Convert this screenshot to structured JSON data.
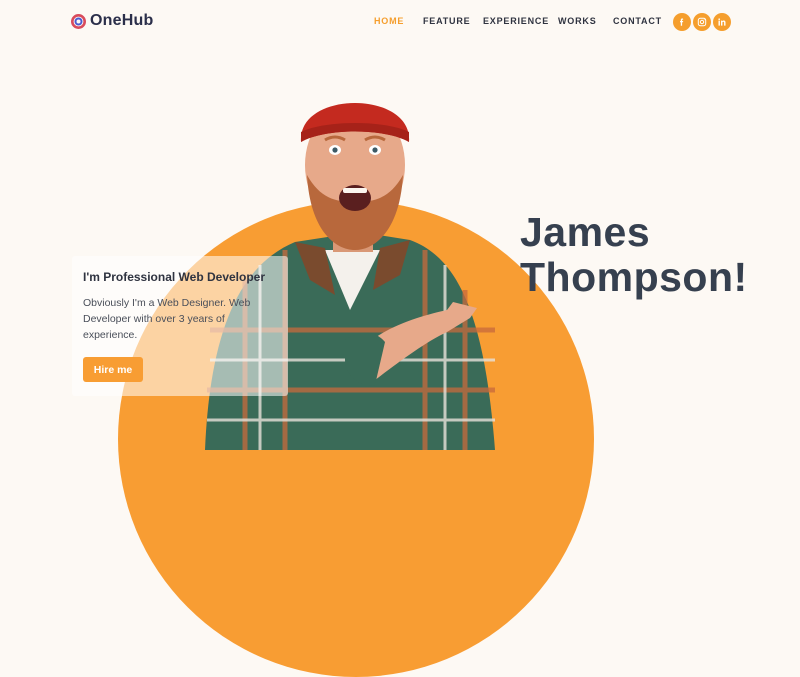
{
  "header": {
    "brand": "OneHub",
    "nav": [
      "HOME",
      "FEATURE",
      "EXPERIENCE",
      "WORKS",
      "CONTACT"
    ],
    "active_nav": "HOME",
    "socials": [
      "facebook-icon",
      "instagram-icon",
      "linkedin-icon"
    ]
  },
  "hero": {
    "subtitle": "I'm Professional Web Developer",
    "description": "Obviously I'm a Web Designer. Web Developer with over 3 years of experience.",
    "cta": "Hire me",
    "name_line1": "James",
    "name_line2": "Thompson!"
  },
  "colors": {
    "accent": "#f89d33",
    "background": "#fdf9f4",
    "heading": "#36404f"
  }
}
